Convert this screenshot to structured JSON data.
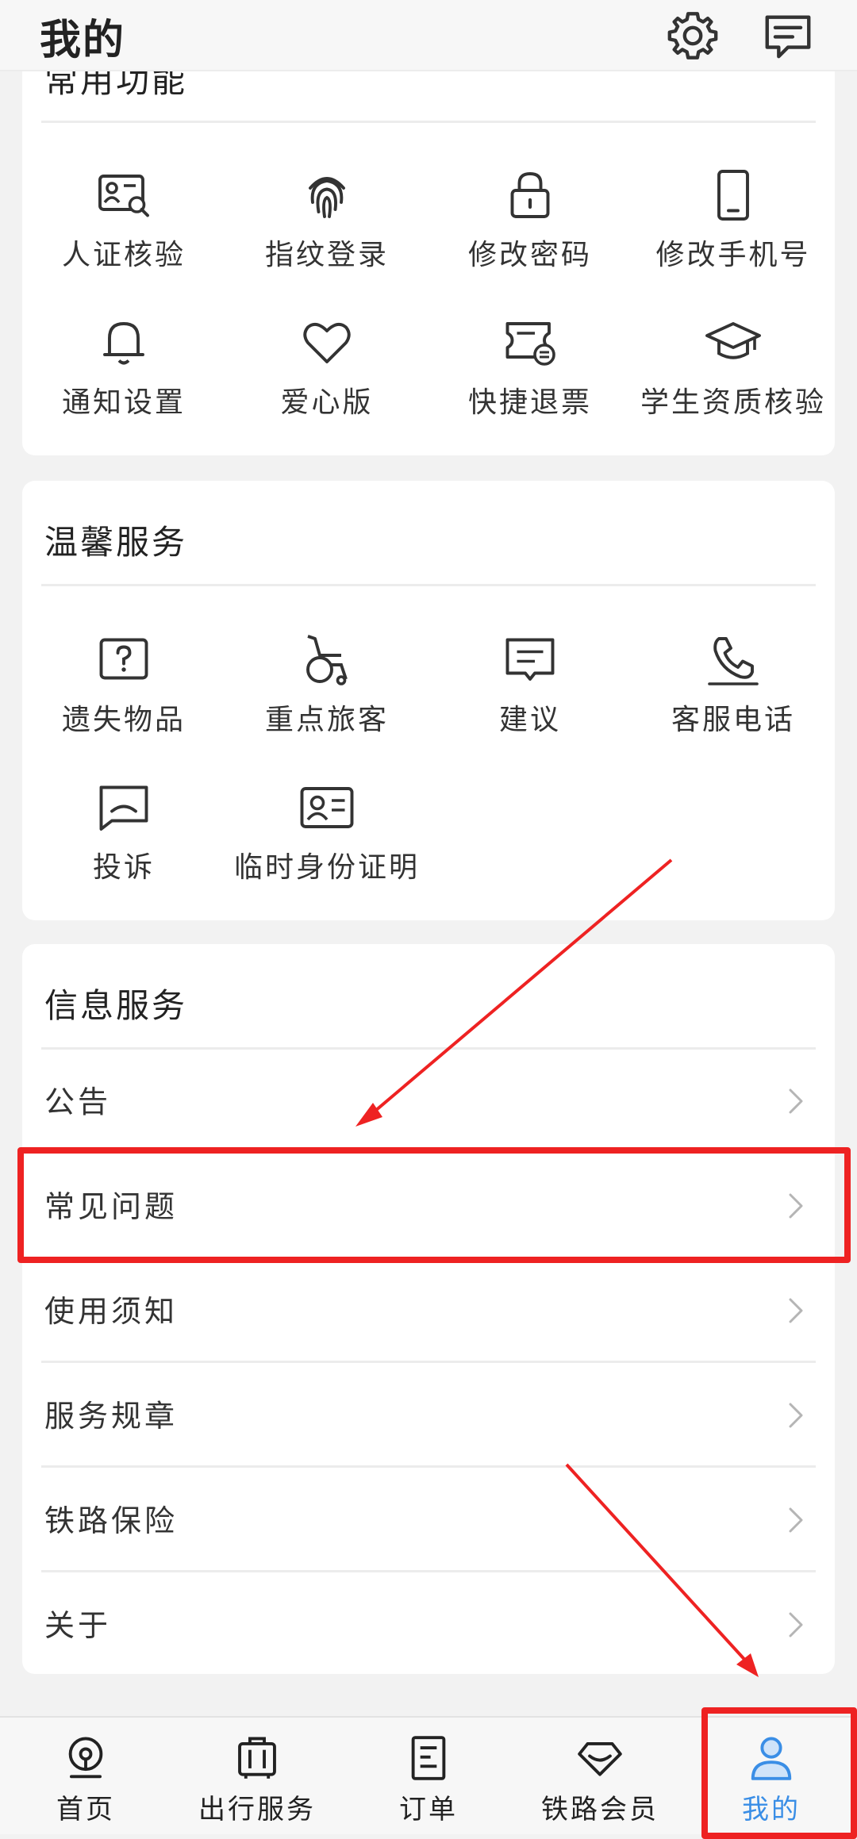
{
  "header": {
    "title": "我的"
  },
  "common": {
    "title": "常用功能",
    "items": [
      {
        "label": "人证核验",
        "icon": "id-verify-icon"
      },
      {
        "label": "指纹登录",
        "icon": "fingerprint-icon"
      },
      {
        "label": "修改密码",
        "icon": "lock-icon"
      },
      {
        "label": "修改手机号",
        "icon": "phone-icon"
      },
      {
        "label": "通知设置",
        "icon": "bell-icon"
      },
      {
        "label": "爱心版",
        "icon": "heart-icon"
      },
      {
        "label": "快捷退票",
        "icon": "ticket-refund-icon"
      },
      {
        "label": "学生资质核验",
        "icon": "graduation-cap-icon"
      }
    ]
  },
  "warm": {
    "title": "温馨服务",
    "items": [
      {
        "label": "遗失物品",
        "icon": "question-box-icon"
      },
      {
        "label": "重点旅客",
        "icon": "wheelchair-icon"
      },
      {
        "label": "建议",
        "icon": "suggestion-icon"
      },
      {
        "label": "客服电话",
        "icon": "phone-call-icon"
      },
      {
        "label": "投诉",
        "icon": "complaint-icon"
      },
      {
        "label": "临时身份证明",
        "icon": "id-card-icon"
      }
    ]
  },
  "info": {
    "title": "信息服务",
    "rows": [
      {
        "label": "公告"
      },
      {
        "label": "常见问题"
      },
      {
        "label": "使用须知"
      },
      {
        "label": "服务规章"
      },
      {
        "label": "铁路保险"
      },
      {
        "label": "关于"
      }
    ]
  },
  "nav": {
    "items": [
      {
        "label": "首页",
        "icon": "railway-home-icon"
      },
      {
        "label": "出行服务",
        "icon": "luggage-icon"
      },
      {
        "label": "订单",
        "icon": "order-icon"
      },
      {
        "label": "铁路会员",
        "icon": "diamond-icon"
      },
      {
        "label": "我的",
        "icon": "person-icon"
      }
    ],
    "active_index": 4
  },
  "colors": {
    "accent": "#3a8ee6",
    "highlight": "#ee2222"
  }
}
